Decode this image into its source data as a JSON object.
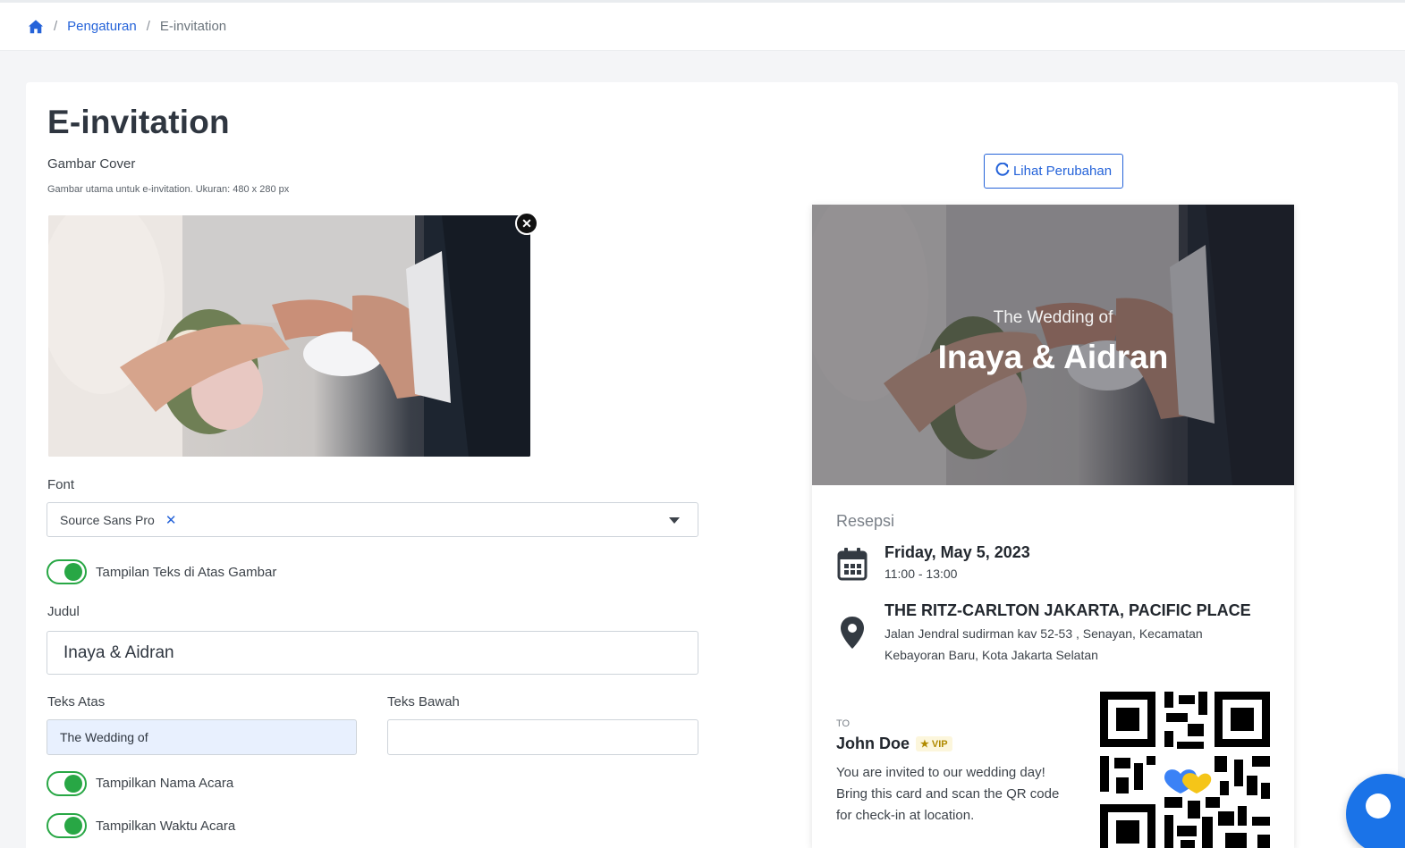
{
  "breadcrumb": {
    "home_icon": "home-icon",
    "items": [
      "Pengaturan",
      "E-invitation"
    ]
  },
  "page": {
    "title": "E-invitation"
  },
  "cover": {
    "label": "Gambar Cover",
    "hint": "Gambar utama untuk e-invitation. Ukuran: 480 x 280 px",
    "remove_icon": "close-icon"
  },
  "font": {
    "label": "Font",
    "selected": "Source Sans Pro",
    "clear": "✕"
  },
  "toggles": {
    "text_over_image": {
      "label": "Tampilan Teks di Atas Gambar",
      "on": true
    },
    "show_event_name": {
      "label": "Tampilkan Nama Acara",
      "on": true
    },
    "show_event_time": {
      "label": "Tampilkan Waktu Acara",
      "on": true
    }
  },
  "fields": {
    "judul": {
      "label": "Judul",
      "value": "Inaya & Aidran"
    },
    "teks_atas": {
      "label": "Teks Atas",
      "value": "The Wedding of"
    },
    "teks_bawah": {
      "label": "Teks Bawah",
      "value": ""
    }
  },
  "preview_button": {
    "label": "Lihat Perubahan",
    "icon": "refresh-icon"
  },
  "invitation": {
    "top_text": "The Wedding of",
    "title": "Inaya & Aidran",
    "event_name": "Resepsi",
    "date": "Friday, May 5, 2023",
    "time": "11:00 - 13:00",
    "venue": "THE RITZ-CARLTON JAKARTA, PACIFIC PLACE",
    "address": "Jalan Jendral sudirman kav 52-53 , Senayan, Kecamatan Kebayoran Baru, Kota Jakarta Selatan",
    "to_label": "TO",
    "guest_name": "John Doe",
    "guest_badge": "VIP",
    "message": "You are invited to our wedding day! Bring this card and scan the QR code for check-in at location."
  },
  "colors": {
    "primary": "#2563d9",
    "success": "#28a745",
    "chat": "#1a73e8"
  }
}
